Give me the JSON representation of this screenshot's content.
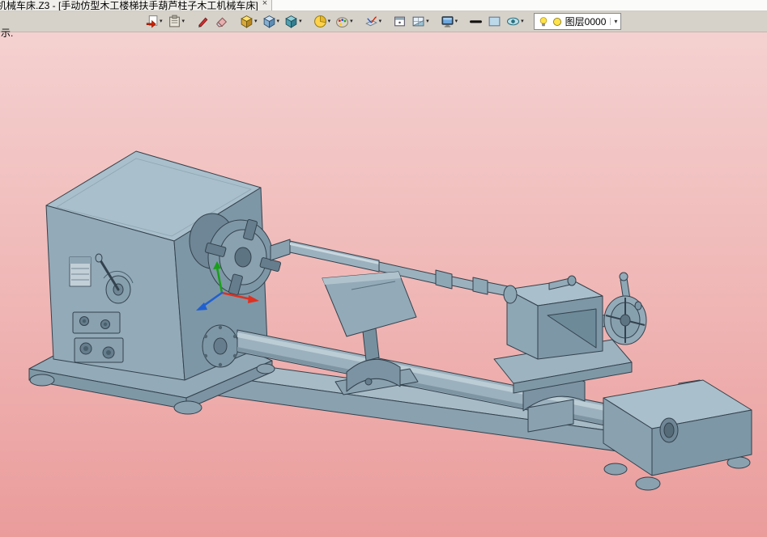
{
  "titlebar": {
    "title": "机械车床.Z3 - [手动仿型木工楼梯扶手葫芦柱子木工机械车床]",
    "close_label": "×"
  },
  "toolbar": {
    "buttons": [
      {
        "name": "view-previous",
        "icon": "page-redo",
        "dropdown": true,
        "gap": false
      },
      {
        "name": "clipboard",
        "icon": "clipboard",
        "dropdown": true,
        "gap": false
      },
      {
        "name": "annotate-pen",
        "icon": "pen-red",
        "dropdown": false,
        "gap": true
      },
      {
        "name": "eraser",
        "icon": "eraser",
        "dropdown": false,
        "gap": false
      },
      {
        "name": "view-orientation",
        "icon": "cube-yellow",
        "dropdown": true,
        "gap": true
      },
      {
        "name": "view-standard",
        "icon": "cube-blue",
        "dropdown": true,
        "gap": false
      },
      {
        "name": "display-style",
        "icon": "cube-shaded",
        "dropdown": true,
        "gap": false
      },
      {
        "name": "render-quality",
        "icon": "pie-yellow",
        "dropdown": true,
        "gap": true
      },
      {
        "name": "appearance-palette",
        "icon": "palette",
        "dropdown": true,
        "gap": false
      },
      {
        "name": "work-plane",
        "icon": "plane-axis",
        "dropdown": true,
        "gap": true
      },
      {
        "name": "viewport-window",
        "icon": "frame",
        "dropdown": false,
        "gap": true
      },
      {
        "name": "grid-display",
        "icon": "grid-plane",
        "dropdown": true,
        "gap": false
      },
      {
        "name": "screen-view",
        "icon": "monitor",
        "dropdown": true,
        "gap": true
      },
      {
        "name": "line-width",
        "icon": "line-black",
        "dropdown": false,
        "gap": true
      },
      {
        "name": "background-color",
        "icon": "swatch-blue",
        "dropdown": false,
        "gap": false
      },
      {
        "name": "visibility",
        "icon": "eye",
        "dropdown": true,
        "gap": false
      }
    ],
    "layer_combo": {
      "value": "图层0000"
    }
  },
  "viewport": {
    "prompt": "示.",
    "background_top": "#f4d1d0",
    "background_bottom": "#ea9c9b",
    "model": "woodworking-copy-lathe",
    "model_fill": "#93aab8",
    "model_light": "#a9bfcb",
    "model_dark": "#7e97a6",
    "model_outline": "#33424d"
  },
  "triad": {
    "x_color": "#e03020",
    "y_color": "#18a018",
    "z_color": "#2060d0"
  }
}
